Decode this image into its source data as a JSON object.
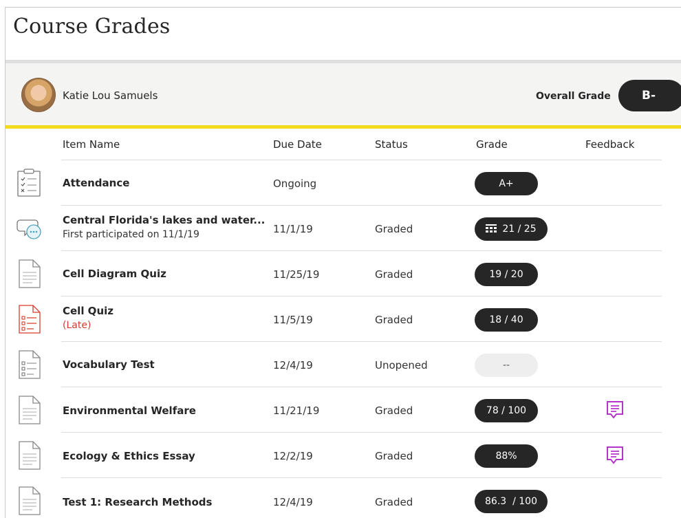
{
  "page": {
    "title": "Course Grades"
  },
  "student": {
    "name": "Katie Lou Samuels",
    "overall_label": "Overall Grade",
    "overall_grade": "B-"
  },
  "columns": {
    "item": "Item Name",
    "due": "Due Date",
    "status": "Status",
    "grade": "Grade",
    "feedback": "Feedback"
  },
  "colors": {
    "accent_yellow": "#f2da1f",
    "feedback_purple": "#b436c9",
    "late_red": "#d63a2f",
    "pill_dark": "#262626"
  },
  "rows": [
    {
      "icon": "attendance-clipboard-icon",
      "name": "Attendance",
      "sub": "",
      "due": "Ongoing",
      "status": "",
      "grade": "A+",
      "feedback": false
    },
    {
      "icon": "discussion-icon",
      "name": "Central Florida's lakes and water...",
      "sub": "First participated on 11/1/19",
      "due": "11/1/19",
      "status": "Graded",
      "grade": "21 / 25",
      "rubric": true,
      "feedback": false
    },
    {
      "icon": "document-icon",
      "name": "Cell Diagram Quiz",
      "sub": "",
      "due": "11/25/19",
      "status": "Graded",
      "grade": "19 / 20",
      "feedback": false
    },
    {
      "icon": "late-test-icon",
      "name": "Cell Quiz",
      "sub": "(Late)",
      "due": "11/5/19",
      "status": "Graded",
      "grade": "18 / 40",
      "feedback": false
    },
    {
      "icon": "test-icon",
      "name": "Vocabulary Test",
      "sub": "",
      "due": "12/4/19",
      "status": "Unopened",
      "grade": "--",
      "feedback": false
    },
    {
      "icon": "document-icon",
      "name": "Environmental Welfare",
      "sub": "",
      "due": "11/21/19",
      "status": "Graded",
      "grade": "78 / 100",
      "feedback": true
    },
    {
      "icon": "document-icon",
      "name": "Ecology & Ethics Essay",
      "sub": "",
      "due": "12/2/19",
      "status": "Graded",
      "grade": "88%",
      "feedback": true
    },
    {
      "icon": "document-icon",
      "name": "Test 1: Research Methods",
      "sub": "",
      "due": "12/4/19",
      "status": "Graded",
      "grade": "86.3  / 100",
      "feedback": false
    }
  ]
}
